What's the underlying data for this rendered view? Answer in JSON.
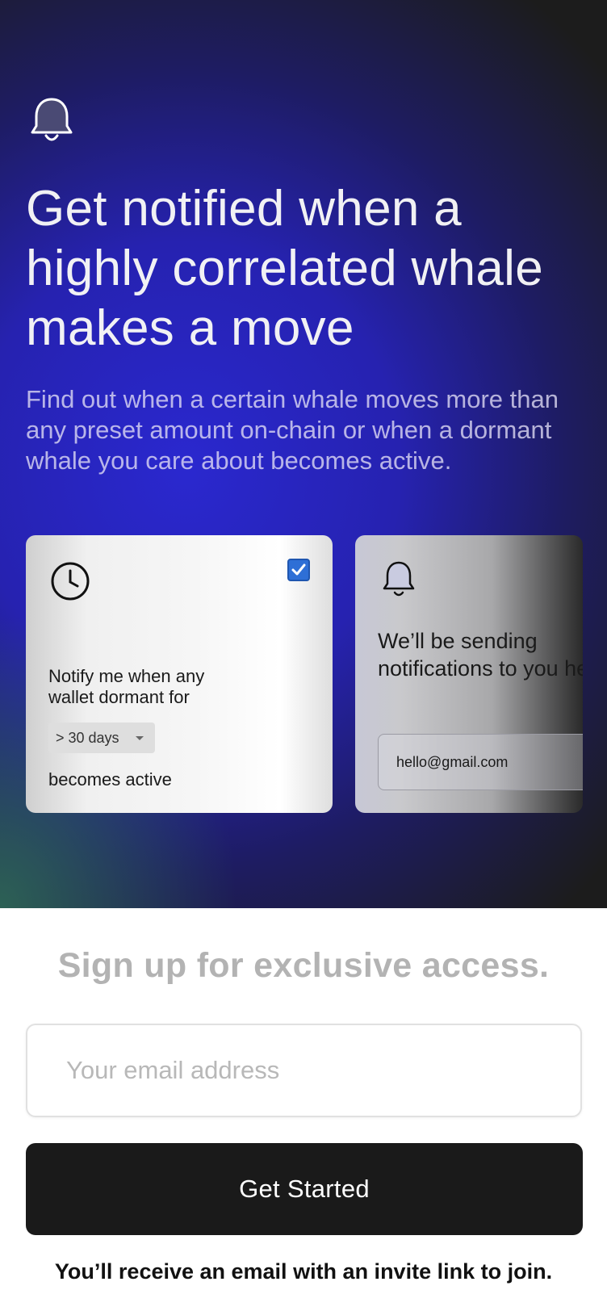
{
  "hero": {
    "icon": "bell-icon",
    "headline": "Get notified when a highly correlated whale makes a move",
    "subtext": "Find out when a certain whale moves more than any preset amount on-chain or when a dormant whale you care about becomes active."
  },
  "cards": {
    "dormant": {
      "icon": "clock-icon",
      "checked": true,
      "text": "Notify me when any wallet dormant for",
      "dropdown_value": "> 30 days",
      "suffix": "becomes active"
    },
    "notify": {
      "icon": "bell-icon",
      "text": "We’ll be sending notifications to you here",
      "email_value": "hello@gmail.com"
    }
  },
  "signup": {
    "title": "Sign up for exclusive access.",
    "email_placeholder": "Your email address",
    "button_label": "Get Started",
    "note": "You’ll receive an email with an invite link to join."
  },
  "colors": {
    "accent_blue": "#2a28cf",
    "dark": "#1a1a1a",
    "checkbox": "#2e6fd6"
  }
}
